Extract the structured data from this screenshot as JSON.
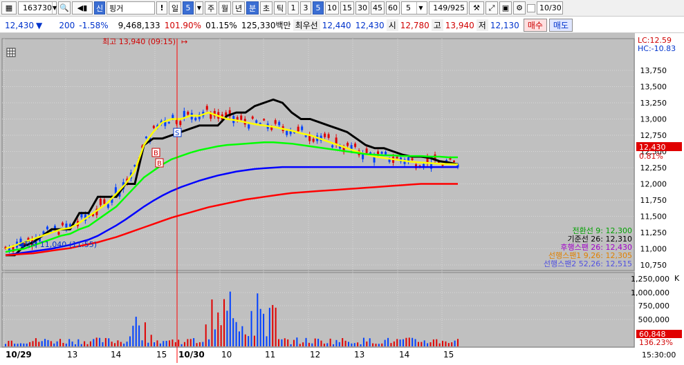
{
  "toolbar": {
    "code": "163730",
    "market_badge": "신",
    "name": "핑거",
    "excl": "!",
    "period_label": "일",
    "period_value": "5",
    "tabs": [
      "주",
      "월",
      "년",
      "분",
      "초",
      "틱"
    ],
    "active_tab": "분",
    "intervals": [
      "1",
      "3",
      "5",
      "10",
      "15",
      "30",
      "45",
      "60"
    ],
    "active_interval": "5",
    "count_select": "5",
    "count_display": "149/925",
    "date_value": "10/30"
  },
  "infobar": {
    "price": "12,430",
    "change_arrow": "▼",
    "change": "200",
    "change_pct": "-1.58%",
    "volume": "9,468,133",
    "vol_ratio": "101.90%",
    "turnover_pct": "01.15%",
    "amount": "125,330백만",
    "best_label": "최우선",
    "best_ask": "12,440",
    "best_bid": "12,430",
    "open_label": "시",
    "open": "12,780",
    "high_label": "고",
    "high": "13,940",
    "low_label": "저",
    "low": "12,130",
    "buy_label": "매수",
    "sell_label": "매도"
  },
  "chart": {
    "top_right": {
      "lc": "LC:12.59",
      "hc": "HC:-10.83"
    },
    "price_axis": [
      "13,750",
      "13,500",
      "13,250",
      "13,000",
      "12,750",
      "12,500",
      "12,250",
      "12,000",
      "11,750",
      "11,500",
      "11,250",
      "11,000",
      "10,750"
    ],
    "current_price_tag": "12,430",
    "current_pct_tag": "0.81%",
    "volume_axis": [
      "1,250,000",
      "1,000,000",
      "750,000",
      "500,000"
    ],
    "volume_unit": "K",
    "volume_tag": "60,848",
    "volume_pct_tag": "136.23%",
    "time_axis": [
      "10/29",
      "13",
      "14",
      "15",
      "10/30",
      "10",
      "11",
      "12",
      "13",
      "14",
      "15"
    ],
    "time_end": "15:30:00",
    "high_annotation": "최고 13,940 (09:15)",
    "low_annotation": "최저 11,040 (11:55)",
    "legend": [
      {
        "text": "전환선 9: 12,300",
        "color": "#00a000"
      },
      {
        "text": "기준선 26: 12,310",
        "color": "#000000"
      },
      {
        "text": "후행스팬 26: 12,430",
        "color": "#a000c8"
      },
      {
        "text": "선행스팬1 9,26: 12,305",
        "color": "#e08000"
      },
      {
        "text": "선행스팬2 52,26: 12,515",
        "color": "#5050e0"
      }
    ],
    "markers": [
      "S",
      "B",
      "B"
    ]
  },
  "chart_data": {
    "type": "line",
    "title": "",
    "ylim": [
      10700,
      13950
    ],
    "series": [
      {
        "name": "",
        "color": "#000000",
        "values": [
          10900,
          10900,
          11040,
          11100,
          11200,
          11300,
          11300,
          11300,
          11550,
          11550,
          11800,
          11800,
          11800,
          12000,
          12000,
          12600,
          12700,
          12700,
          12750,
          12800,
          12850,
          12900,
          12900,
          12900,
          13050,
          13100,
          13100,
          13200,
          13250,
          13300,
          13250,
          13100,
          13000,
          13000,
          12950,
          12900,
          12850,
          12800,
          12700,
          12600,
          12550,
          12550,
          12500,
          12450,
          12420,
          12420,
          12400,
          12350,
          12330,
          12300
        ]
      },
      {
        "name": "",
        "color": "#ffff00",
        "values": [
          11000,
          11050,
          11100,
          11150,
          11200,
          11250,
          11300,
          11320,
          11400,
          11500,
          11600,
          11700,
          11850,
          12000,
          12200,
          12600,
          12800,
          12950,
          13000,
          13000,
          13050,
          13050,
          13100,
          13050,
          13000,
          12980,
          12950,
          12920,
          12900,
          12880,
          12850,
          12820,
          12780,
          12750,
          12700,
          12650,
          12600,
          12550,
          12500,
          12460,
          12420,
          12400,
          12380,
          12360,
          12340,
          12330,
          12320,
          12310,
          12305,
          12300
        ]
      },
      {
        "name": "",
        "color": "#00ff00",
        "values": [
          10950,
          10980,
          11000,
          11050,
          11100,
          11150,
          11200,
          11230,
          11300,
          11350,
          11450,
          11550,
          11650,
          11800,
          11950,
          12100,
          12200,
          12300,
          12380,
          12430,
          12480,
          12520,
          12550,
          12580,
          12600,
          12610,
          12620,
          12630,
          12640,
          12640,
          12630,
          12620,
          12600,
          12580,
          12560,
          12540,
          12520,
          12500,
          12480,
          12460,
          12450,
          12440,
          12440,
          12430,
          12430,
          12430,
          12420,
          12420,
          12410,
          12410
        ]
      },
      {
        "name": "",
        "color": "#0000ff",
        "values": [
          10900,
          10920,
          10940,
          10960,
          10980,
          11000,
          11030,
          11060,
          11100,
          11140,
          11200,
          11280,
          11360,
          11450,
          11550,
          11650,
          11740,
          11820,
          11890,
          11950,
          12000,
          12050,
          12090,
          12130,
          12160,
          12190,
          12210,
          12230,
          12240,
          12250,
          12260,
          12260,
          12260,
          12260,
          12260,
          12260,
          12260,
          12260,
          12260,
          12260,
          12260,
          12260,
          12260,
          12260,
          12260,
          12260,
          12260,
          12260,
          12260,
          12260
        ]
      },
      {
        "name": "",
        "color": "#ff0000",
        "values": [
          10900,
          10910,
          10920,
          10930,
          10950,
          10970,
          10990,
          11010,
          11040,
          11070,
          11100,
          11140,
          11180,
          11230,
          11280,
          11330,
          11380,
          11430,
          11480,
          11520,
          11560,
          11600,
          11640,
          11670,
          11700,
          11730,
          11760,
          11780,
          11800,
          11820,
          11840,
          11860,
          11870,
          11880,
          11890,
          11900,
          11910,
          11920,
          11930,
          11940,
          11950,
          11960,
          11970,
          11980,
          11990,
          12000,
          12000,
          12000,
          12000,
          12000
        ]
      }
    ]
  }
}
